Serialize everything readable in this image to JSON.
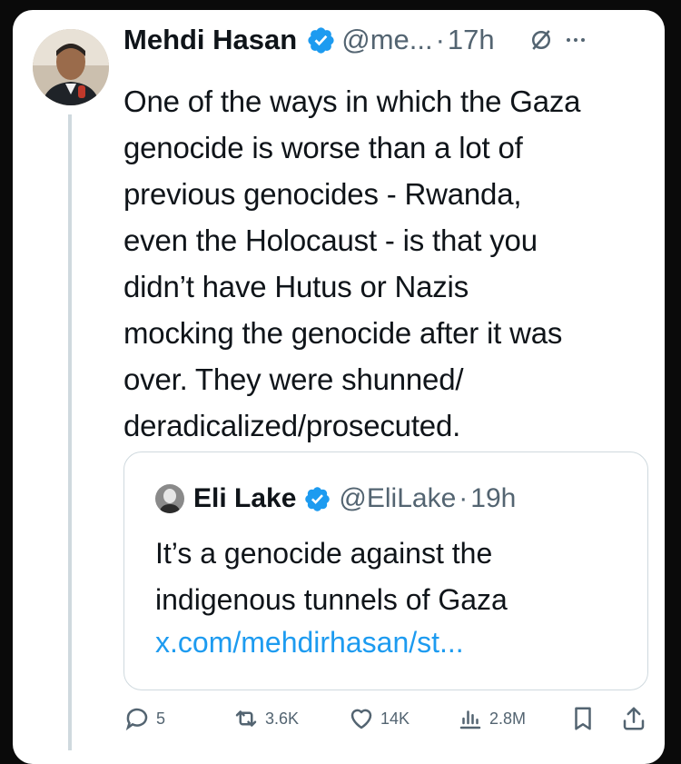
{
  "tweet": {
    "author_name": "Mehdi Hasan",
    "handle": "@me...",
    "separator": "·",
    "time": "17h",
    "text": "One of the ways in which the Gaza\ngenocide is worse than a lot of\nprevious genocides - Rwanda,\neven the Holocaust - is that you\ndidn’t have Hutus or Nazis\nmocking the genocide after it was\nover. They were shunned/\nderadicalized/prosecuted."
  },
  "quote": {
    "author_name": "Eli Lake",
    "handle": "@EliLake",
    "separator": "·",
    "time": "19h",
    "text": "It’s a genocide against the indigenous tunnels of Gaza",
    "link": "x.com/mehdirhasan/st..."
  },
  "actions": {
    "replies": "5",
    "reposts": "3.6K",
    "likes": "14K",
    "views": "2.8M"
  },
  "icons": {
    "verified": "verified-badge-icon",
    "grok": "grok-icon",
    "more": "more-dots-icon",
    "reply": "reply-icon",
    "repost": "repost-icon",
    "like": "heart-icon",
    "views": "views-icon",
    "bookmark": "bookmark-icon",
    "share": "share-icon"
  },
  "colors": {
    "text": "#0f1419",
    "secondary": "#536471",
    "link": "#1d9bf0",
    "verified": "#1d9bf0",
    "background": "#0a0a0a",
    "card": "#ffffff"
  }
}
